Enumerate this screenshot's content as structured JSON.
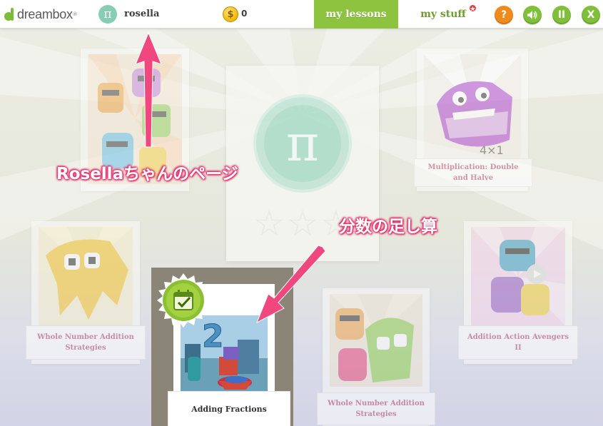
{
  "topbar": {
    "logo_text": "dreambox",
    "user_name": "rosella",
    "avatar_symbol": "π",
    "coin_symbol": "$",
    "coin_count": "0",
    "tabs": {
      "lessons_label": "my lessons",
      "stuff_label": "my stuff",
      "stuff_badge": "★"
    },
    "buttons": {
      "help": "?",
      "sound": "🔊",
      "pause": "II",
      "close": "X"
    }
  },
  "center": {
    "pi_symbol": "π",
    "stars": "☆☆☆"
  },
  "lessons": [
    {
      "title": "",
      "art": "robot-heroes-jumping"
    },
    {
      "title": "Multiplication: Double and Halve",
      "art": "purple-monster-4x1"
    },
    {
      "title": "Whole Number Addition Strategies",
      "art": "yellow-ghost-monster"
    },
    {
      "title": "Addition Action Avengers II",
      "art": "pink-robot-heroes"
    },
    {
      "title": "Adding Fractions",
      "art": "number-monsters-wheelbarrow",
      "selected": true
    },
    {
      "title": "Whole Number Addition Strategies",
      "art": "green-monster-robots"
    }
  ],
  "annotations": {
    "rosella_page": "Rosellaちゃんのページ",
    "adding_fractions": "分数の足し算"
  },
  "colors": {
    "accent_green": "#8ec33f",
    "title_pink": "#c43f63",
    "annotation_pink": "#e8336e",
    "help_orange": "#f08a1c",
    "pi_mint": "#a7dcc8"
  }
}
